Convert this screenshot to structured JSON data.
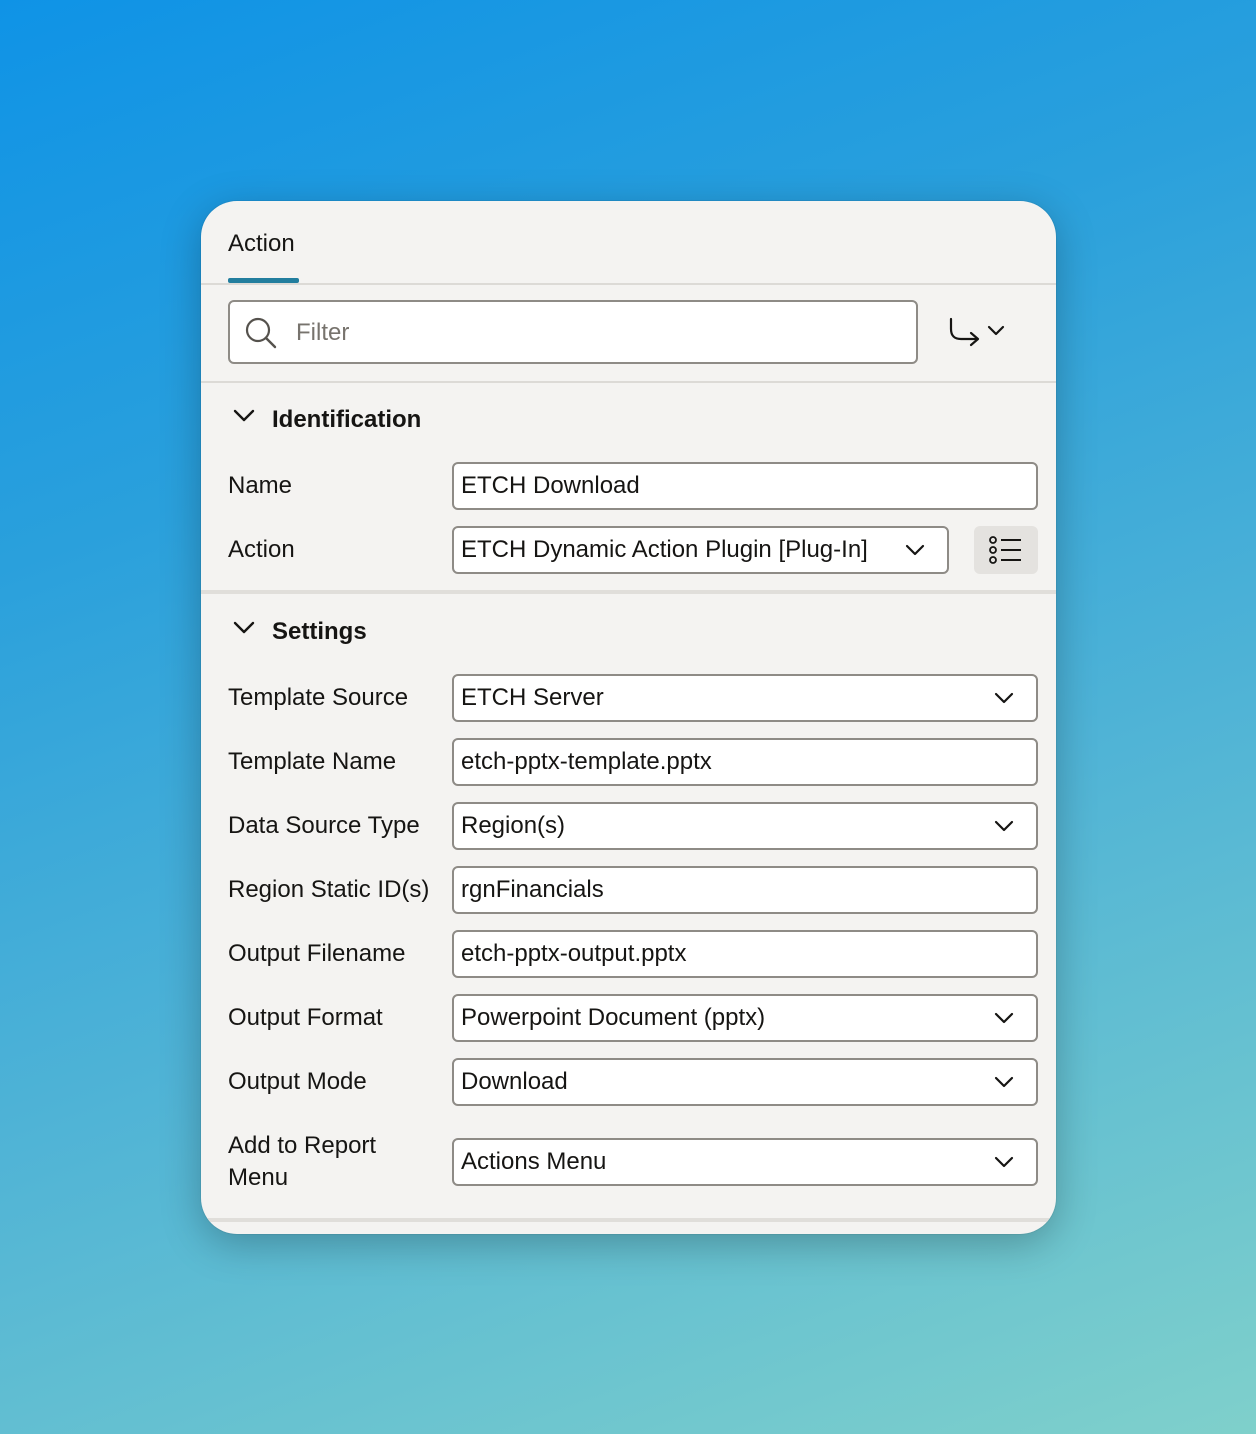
{
  "tabs": [
    {
      "label": "Action",
      "active": true
    }
  ],
  "filter": {
    "placeholder": "Filter",
    "value": ""
  },
  "toolbar": {
    "goto_icon": "go-to-group-icon",
    "dropdown_icon": "chevron-down-icon"
  },
  "sections": {
    "identification": {
      "title": "Identification",
      "name_label": "Name",
      "name_value": "ETCH Download",
      "action_label": "Action",
      "action_value": "ETCH Dynamic Action Plugin [Plug-In]",
      "action_list_icon": "list-icon"
    },
    "settings": {
      "title": "Settings",
      "fields": [
        {
          "label": "Template Source",
          "value": "ETCH Server",
          "type": "select"
        },
        {
          "label": "Template Name",
          "value": "etch-pptx-template.pptx",
          "type": "text"
        },
        {
          "label": "Data Source Type",
          "value": "Region(s)",
          "type": "select"
        },
        {
          "label": "Region Static ID(s)",
          "value": "rgnFinancials",
          "type": "text"
        },
        {
          "label": "Output Filename",
          "value": "etch-pptx-output.pptx",
          "type": "text"
        },
        {
          "label": "Output Format",
          "value": "Powerpoint Document (pptx)",
          "type": "select"
        },
        {
          "label": "Output Mode",
          "value": "Download",
          "type": "select"
        },
        {
          "label": "Add to Report Menu",
          "value": "Actions Menu",
          "type": "select"
        }
      ]
    }
  },
  "colors": {
    "accent": "#227e9e",
    "panel": "#f4f3f1",
    "border": "#8e8b86"
  }
}
